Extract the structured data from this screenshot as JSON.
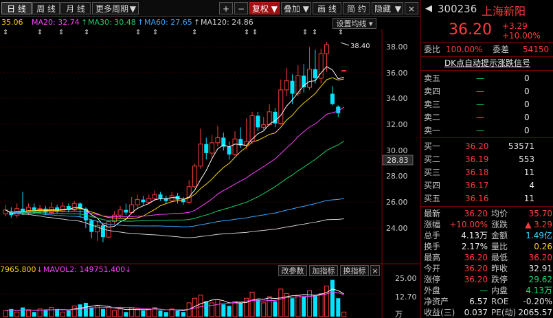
{
  "toolbar": {
    "tabs": [
      "日 线",
      "周 线",
      "月 线"
    ],
    "more_period": "更多周期",
    "plus": "+",
    "minus": "−",
    "restore": "复权",
    "overlay": "叠加",
    "draw": "画 线",
    "simple": "简 约",
    "hide": "隐藏",
    "close": "×"
  },
  "ma_labels": {
    "ma5": "35.06",
    "ma20": "MA20: 32.74",
    "ma30": "MA30: 30.48",
    "ma60": "MA60: 27.65",
    "ma120": "MA120: 24.86",
    "settings": "设置均线"
  },
  "price_axis": {
    "ticks": [
      "38.00",
      "36.00",
      "34.00",
      "32.00",
      "30.00",
      "28.00",
      "26.00",
      "24.00"
    ],
    "current": "28.83",
    "peak_label": "38.40"
  },
  "volume": {
    "labels": {
      "mavol1": "7965.800",
      "mavol2": "MAVOL2: 149751.400"
    },
    "buttons": [
      "改参数",
      "加指标",
      "换指标"
    ],
    "ticks": [
      "25.00",
      "12.70",
      "万"
    ],
    "colors": {
      "up": "#ff3b3b",
      "down": "#00e5ff",
      "ma1": "#ffffff",
      "ma2": "#ff40ff"
    }
  },
  "colors": {
    "ma5": "#ffffff",
    "ma10": "#ffd200",
    "ma20": "#ff40ff",
    "ma30": "#18d36b",
    "ma60": "#3aa8ff",
    "ma120": "#d0d0d0",
    "up": "#ff3b3b",
    "down": "#00e5ff"
  },
  "stock": {
    "code": "300236",
    "name": "上海新阳",
    "price": "36.20",
    "change": "+3.29",
    "change_pct": "+10.00%",
    "webi_label": "委比",
    "webi": "100.00%",
    "weicha_label": "委差",
    "weicha": "54150",
    "signal": "DK点自动提示涨跌信号"
  },
  "sell": [
    {
      "label": "卖五",
      "price": "—",
      "vol": "0"
    },
    {
      "label": "卖四",
      "price": "—",
      "vol": "0"
    },
    {
      "label": "卖三",
      "price": "—",
      "vol": "0"
    },
    {
      "label": "卖二",
      "price": "—",
      "vol": "0"
    },
    {
      "label": "卖一",
      "price": "—",
      "vol": "0"
    }
  ],
  "buy": [
    {
      "label": "买一",
      "price": "36.20",
      "vol": "53571"
    },
    {
      "label": "买二",
      "price": "36.19",
      "vol": "553"
    },
    {
      "label": "买三",
      "price": "36.18",
      "vol": "11"
    },
    {
      "label": "买四",
      "price": "36.17",
      "vol": "4"
    },
    {
      "label": "买五",
      "price": "36.16",
      "vol": "11"
    }
  ],
  "stats": [
    {
      "l1": "最新",
      "v1": "36.20",
      "c1": "red",
      "l2": "均价",
      "v2": "35.70",
      "c2": "red"
    },
    {
      "l1": "涨幅",
      "v1": "+10.00%",
      "c1": "red",
      "l2": "涨跌",
      "v2": "▲ 3.29",
      "c2": "red"
    },
    {
      "l1": "总手",
      "v1": "4.13万",
      "c1": "wht",
      "l2": "金额",
      "v2": "1.49亿",
      "c2": "cy"
    },
    {
      "l1": "换手",
      "v1": "2.17%",
      "c1": "wht",
      "l2": "量比",
      "v2": "0.26",
      "c2": "yel"
    },
    {
      "l1": "最高",
      "v1": "36.20",
      "c1": "red",
      "l2": "最低",
      "v2": "36.20",
      "c2": "red"
    },
    {
      "l1": "今开",
      "v1": "36.20",
      "c1": "red",
      "l2": "昨收",
      "v2": "32.91",
      "c2": "wht"
    },
    {
      "l1": "涨停",
      "v1": "36.20",
      "c1": "red",
      "l2": "跌停",
      "v2": "29.62",
      "c2": "grn"
    },
    {
      "l1": "外盘",
      "v1": "—",
      "c1": "grn",
      "l2": "内盘",
      "v2": "4.13万",
      "c2": "grn"
    },
    {
      "l1": "净资产",
      "v1": "6.57",
      "c1": "wht",
      "l2": "ROE",
      "v2": "-0.20%",
      "c2": "wht"
    },
    {
      "l1": "收益(三)",
      "v1": "0.037",
      "c1": "wht",
      "l2": "PE(动)",
      "v2": "2065.57",
      "c2": "wht"
    }
  ]
}
